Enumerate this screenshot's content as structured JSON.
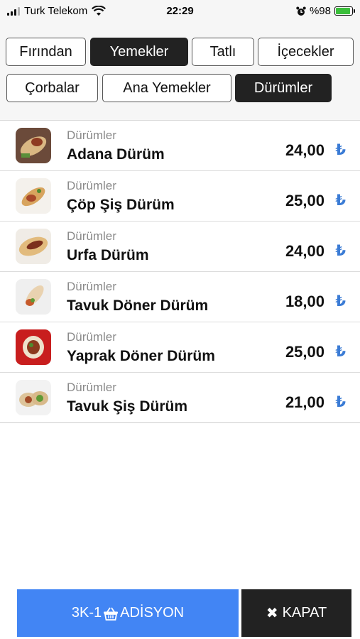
{
  "status_bar": {
    "carrier": "Turk Telekom",
    "time": "22:29",
    "battery": "%98",
    "battery_level": 0.98,
    "icons": [
      "signal-icon",
      "wifi-icon",
      "alarm-icon",
      "battery-icon"
    ]
  },
  "categories": {
    "row1": [
      {
        "label": "Fırından",
        "active": false
      },
      {
        "label": "Yemekler",
        "active": true
      },
      {
        "label": "Tatlı",
        "active": false
      },
      {
        "label": "İçecekler",
        "active": false
      }
    ],
    "row2": [
      {
        "label": "Çorbalar",
        "active": false
      },
      {
        "label": "Ana Yemekler",
        "active": false
      },
      {
        "label": "Dürümler",
        "active": true
      }
    ]
  },
  "products": [
    {
      "category": "Dürümler",
      "name": "Adana Dürüm",
      "price": "24,00",
      "currency": "₺",
      "thumb": "durum-photo"
    },
    {
      "category": "Dürümler",
      "name": "Çöp Şiş Dürüm",
      "price": "25,00",
      "currency": "₺",
      "thumb": "durum-photo"
    },
    {
      "category": "Dürümler",
      "name": "Urfa Dürüm",
      "price": "24,00",
      "currency": "₺",
      "thumb": "durum-photo"
    },
    {
      "category": "Dürümler",
      "name": "Tavuk Döner Dürüm",
      "price": "18,00",
      "currency": "₺",
      "thumb": "durum-photo"
    },
    {
      "category": "Dürümler",
      "name": "Yaprak Döner Dürüm",
      "price": "25,00",
      "currency": "₺",
      "thumb": "durum-photo"
    },
    {
      "category": "Dürümler",
      "name": "Tavuk Şiş Dürüm",
      "price": "21,00",
      "currency": "₺",
      "thumb": "durum-photo"
    }
  ],
  "bottom": {
    "adisyon_prefix": "3K-1",
    "adisyon_label": "ADİSYON",
    "adisyon_icon": "basket-icon",
    "close_label": "KAPAT",
    "close_icon": "close-icon",
    "colors": {
      "adisyon": "#4285f4",
      "close": "#222222"
    }
  }
}
